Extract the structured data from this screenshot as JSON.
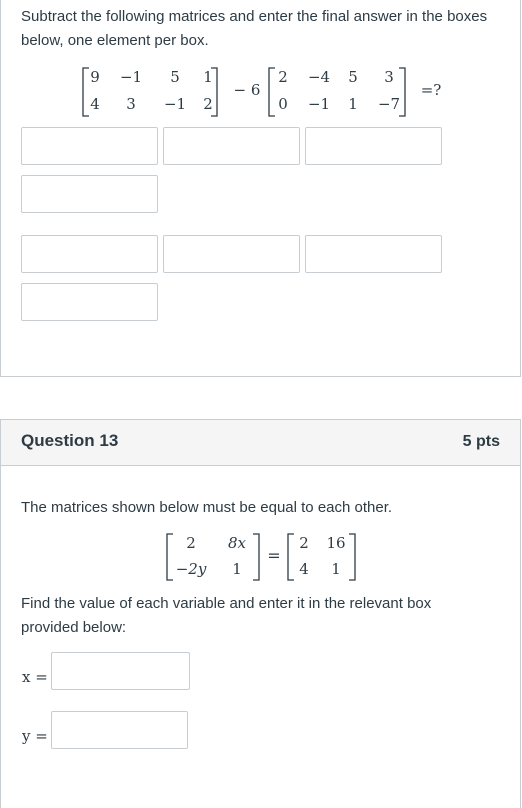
{
  "q12": {
    "prompt": "Subtract the following matrices and enter the final answer in the boxes below, one element per box.",
    "matrix_a": [
      [
        "9",
        "−1",
        "5",
        "1"
      ],
      [
        "4",
        "3",
        "−1",
        "2"
      ]
    ],
    "operator": "− 6",
    "matrix_b": [
      [
        "2",
        "−4",
        "5",
        "3"
      ],
      [
        "0",
        "−1",
        "1",
        "−7"
      ]
    ],
    "result": "=?"
  },
  "q13": {
    "title": "Question 13",
    "points": "5 pts",
    "intro": "The matrices shown below must be equal to each other.",
    "matrix_left": [
      [
        "2",
        "8x"
      ],
      [
        "−2y",
        "1"
      ]
    ],
    "equals": "=",
    "matrix_right": [
      [
        "2",
        "16"
      ],
      [
        "4",
        "1"
      ]
    ],
    "instruction": "Find the value of each variable and enter it in the relevant box provided below:",
    "x_label": "x =",
    "y_label": "y ="
  }
}
